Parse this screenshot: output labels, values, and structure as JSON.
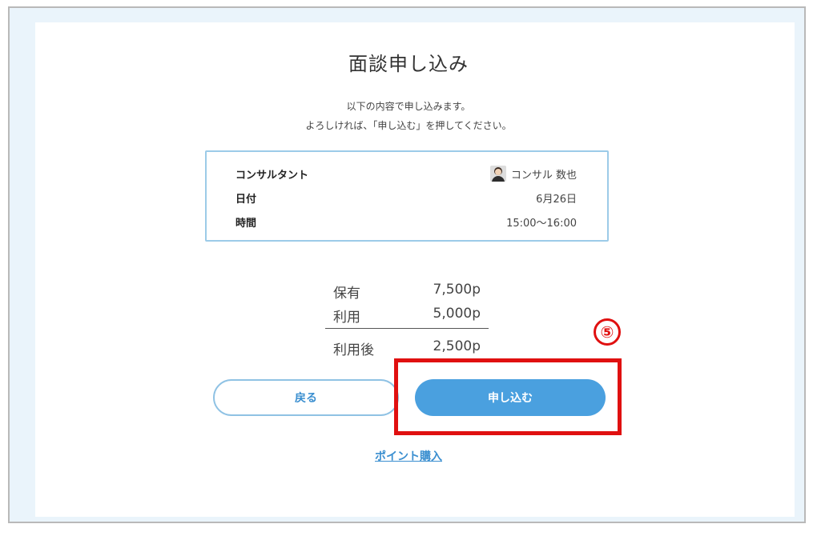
{
  "page": {
    "title": "面談申し込み",
    "message_line1": "以下の内容で申し込みます。",
    "message_line2": "よろしければ、「申し込む」を押してください。"
  },
  "details": {
    "consultant_label": "コンサルタント",
    "consultant_value": "コンサル 数也",
    "date_label": "日付",
    "date_value": "6月26日",
    "time_label": "時間",
    "time_value": "15:00〜16:00"
  },
  "points": {
    "held_label": "保有",
    "held_value": "7,500p",
    "use_label": "利用",
    "use_value": "5,000p",
    "after_label": "利用後",
    "after_value": "2,500p"
  },
  "buttons": {
    "back_label": "戻る",
    "apply_label": "申し込む"
  },
  "annotation": {
    "step_label": "⑤",
    "color": "#e01010"
  },
  "link": {
    "purchase_label": "ポイント購入"
  }
}
